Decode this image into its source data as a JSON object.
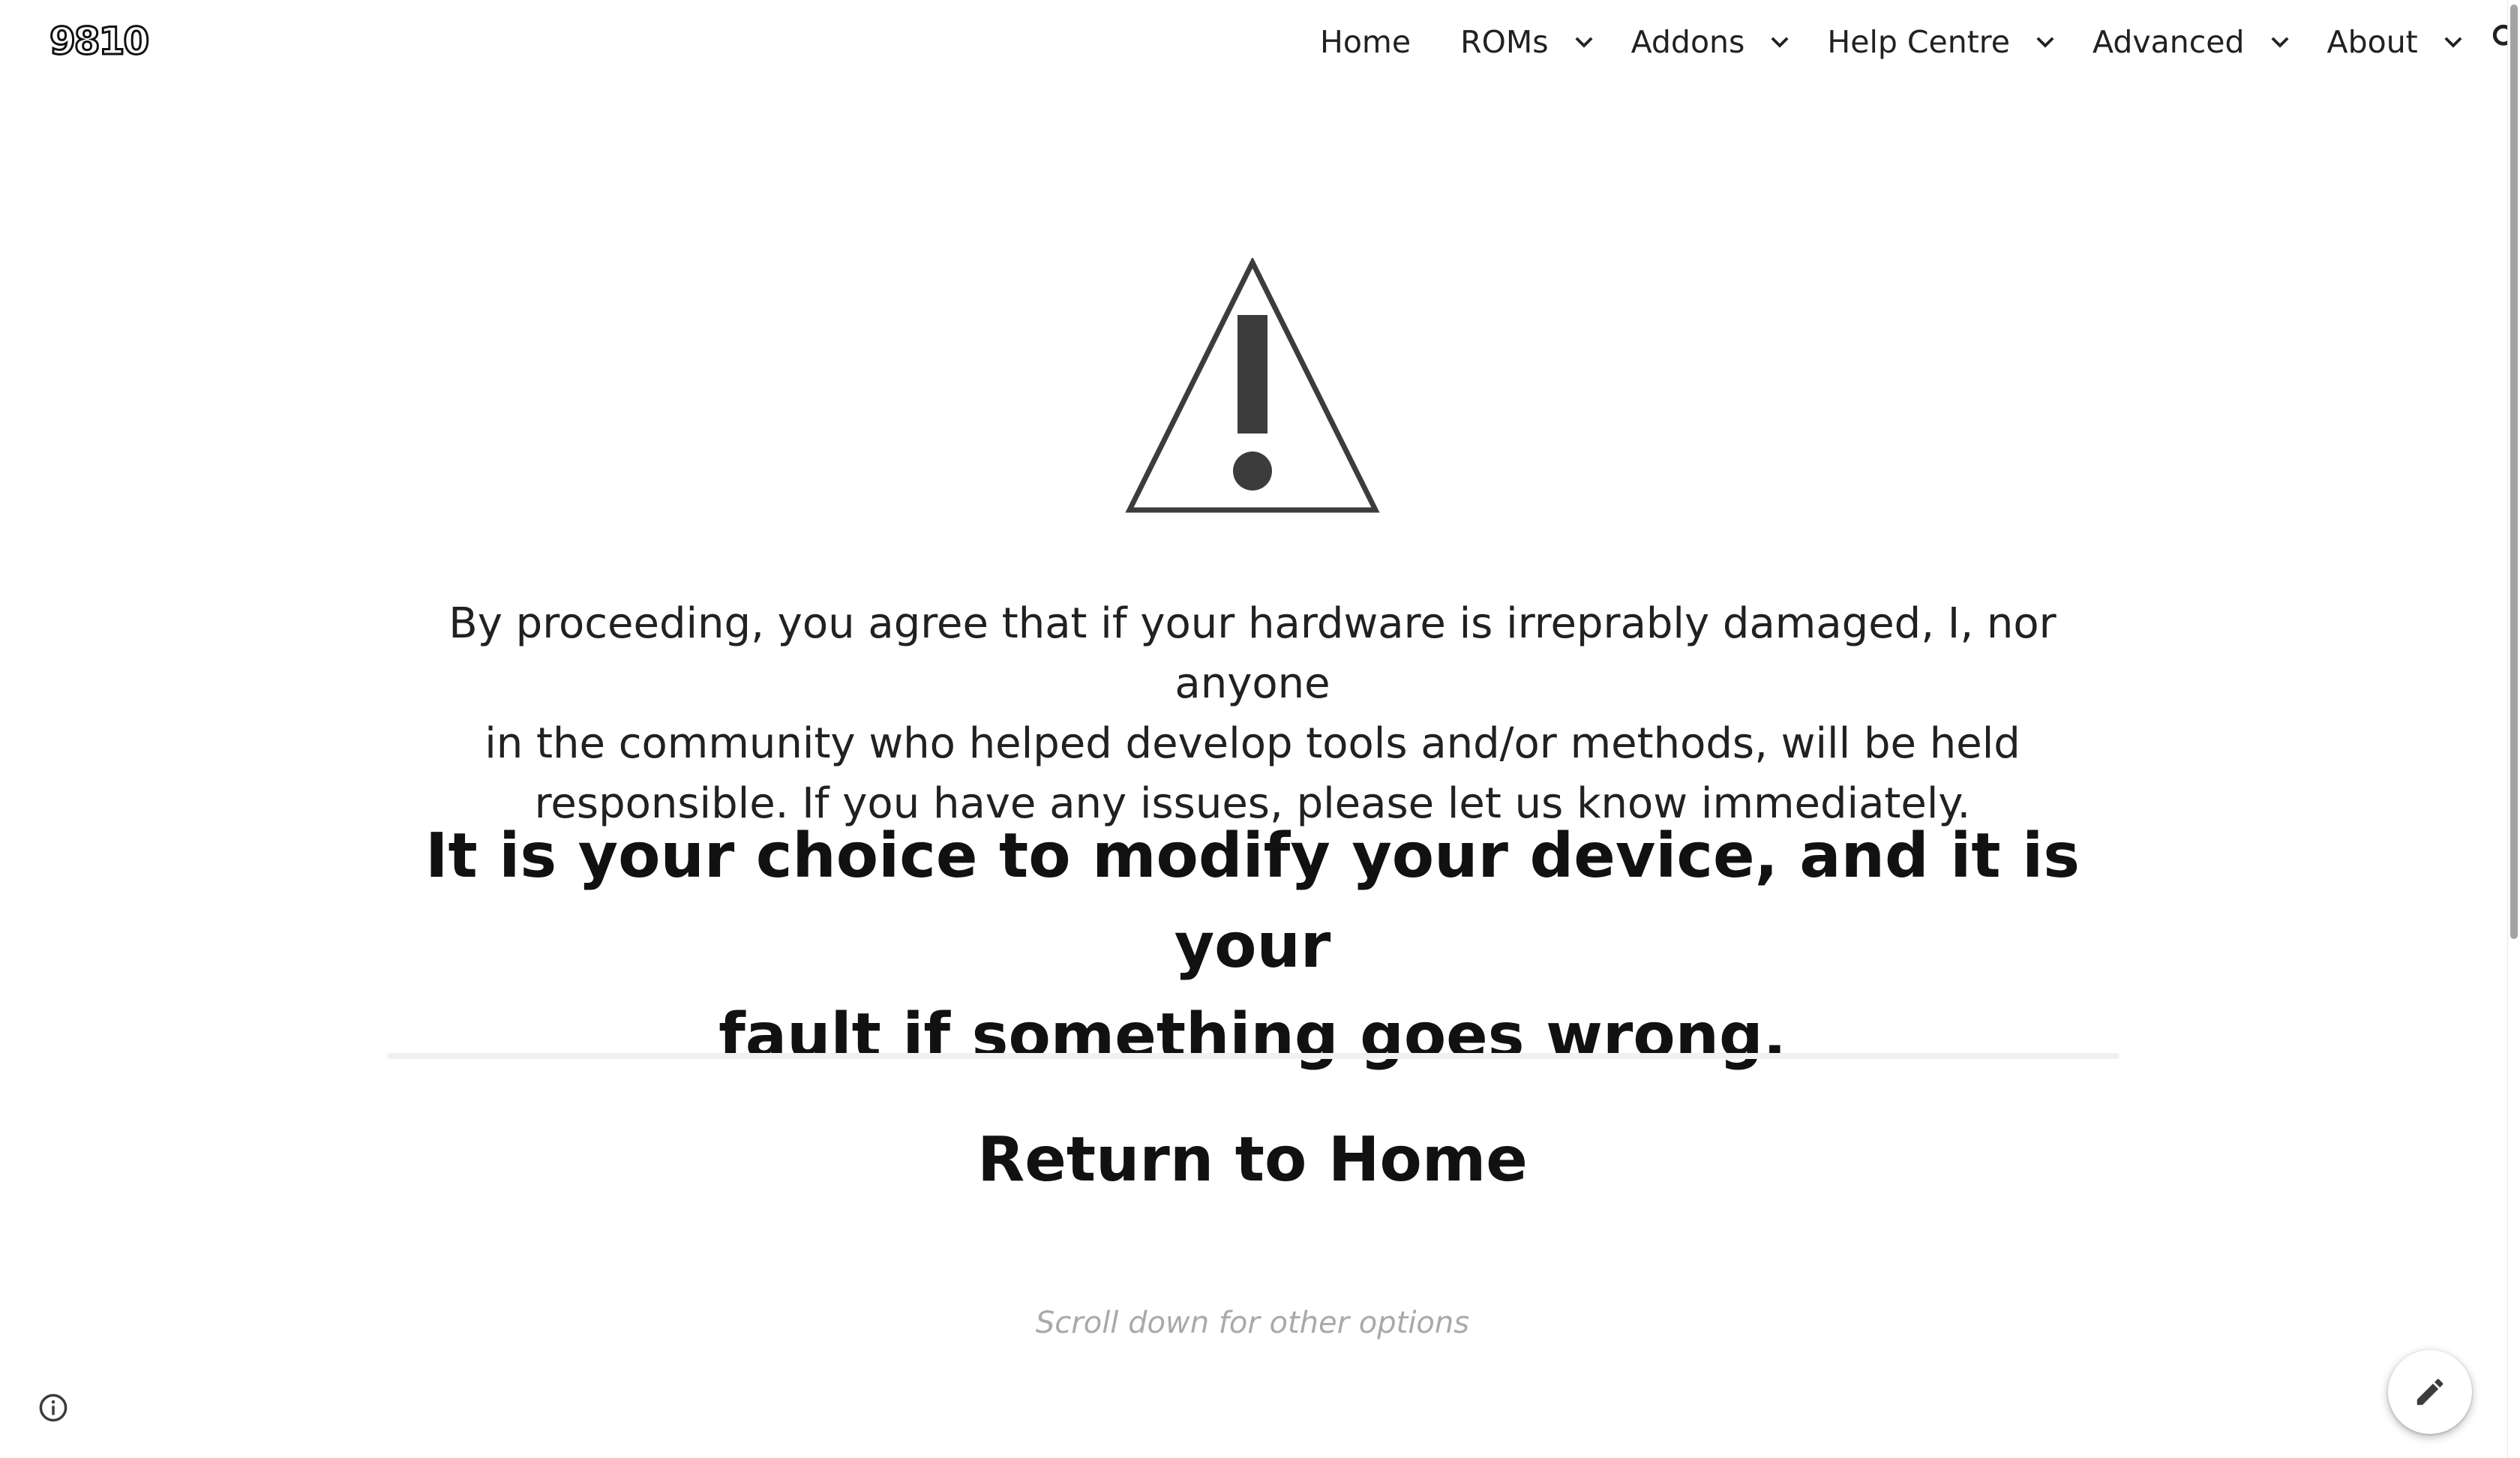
{
  "site": {
    "logo_text": "9810"
  },
  "nav": {
    "home": "Home",
    "roms": "ROMs",
    "addons": "Addons",
    "help_centre": "Help Centre",
    "advanced": "Advanced",
    "about": "About",
    "search_icon": "search-icon",
    "dropdown_icon": "chevron-down-icon"
  },
  "main": {
    "warning_icon": "warning-triangle-icon",
    "disclaimer_line1": "By proceeding, you agree that if your hardware is irreprably damaged, I, nor anyone",
    "disclaimer_line2": "in the community who helped develop tools and/or methods, will be held",
    "disclaimer_line3": "responsible. If you have any issues, please let us know immediately.",
    "bold_line1": "It is your choice to modify your device, and it is your",
    "bold_line2": "fault if something goes wrong.",
    "return_link": "Return to Home",
    "scroll_hint": "Scroll down for other options"
  },
  "footer": {
    "info_icon": "info-icon",
    "edit_icon": "pencil-icon"
  },
  "colors": {
    "text": "#212121",
    "icon": "#3c3c3c",
    "hint": "#a9a9a9",
    "divider": "#f1f1f1"
  }
}
